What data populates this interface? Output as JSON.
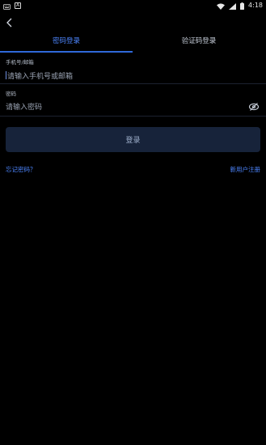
{
  "status_bar": {
    "time": "4:18",
    "notification_label": "A"
  },
  "tabs": [
    {
      "label": "密码登录",
      "active": true
    },
    {
      "label": "验证码登录",
      "active": false
    }
  ],
  "account_field": {
    "label": "手机号/邮箱",
    "placeholder": "请输入手机号或邮箱"
  },
  "password_field": {
    "label": "密码",
    "placeholder": "请输入密码"
  },
  "login_button": {
    "label": "登录"
  },
  "links": {
    "forgot_password": "忘记密码？",
    "register": "新用户注册"
  },
  "colors": {
    "background": "#000000",
    "accent": "#4d86ff",
    "button_bg": "#17233a"
  }
}
